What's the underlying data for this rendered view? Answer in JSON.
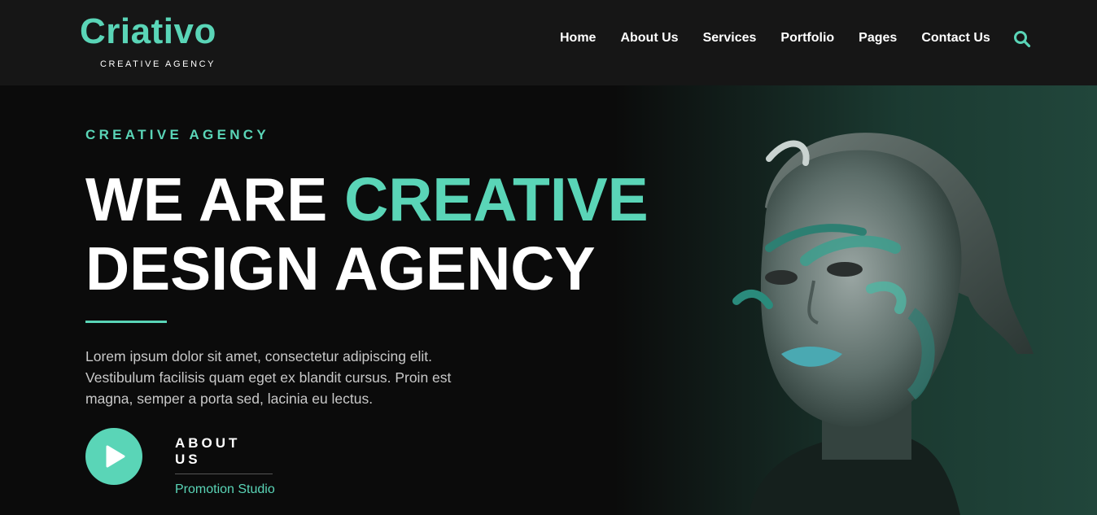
{
  "brand": {
    "name": "Criativo",
    "tagline": "CREATIVE AGENCY",
    "accent_color": "#5ad5b7"
  },
  "nav": {
    "items": [
      {
        "label": "Home"
      },
      {
        "label": "About Us"
      },
      {
        "label": "Services"
      },
      {
        "label": "Portfolio"
      },
      {
        "label": "Pages"
      },
      {
        "label": "Contact Us"
      }
    ],
    "search_icon": "search-icon"
  },
  "hero": {
    "eyebrow": "CREATIVE AGENCY",
    "headline_part1": "WE ARE ",
    "headline_accent": "CREATIVE",
    "headline_line2": "DESIGN AGENCY",
    "description": "Lorem ipsum dolor sit amet, consectetur adipiscing elit. Vestibulum facilisis quam eget ex blandit cursus. Proin est magna, semper a porta sed, lacinia eu lectus.",
    "play_icon": "play-icon",
    "cta_label": "ABOUT US",
    "cta_subtitle": "Promotion Studio",
    "image": "portrait-with-teal-face-paint"
  }
}
